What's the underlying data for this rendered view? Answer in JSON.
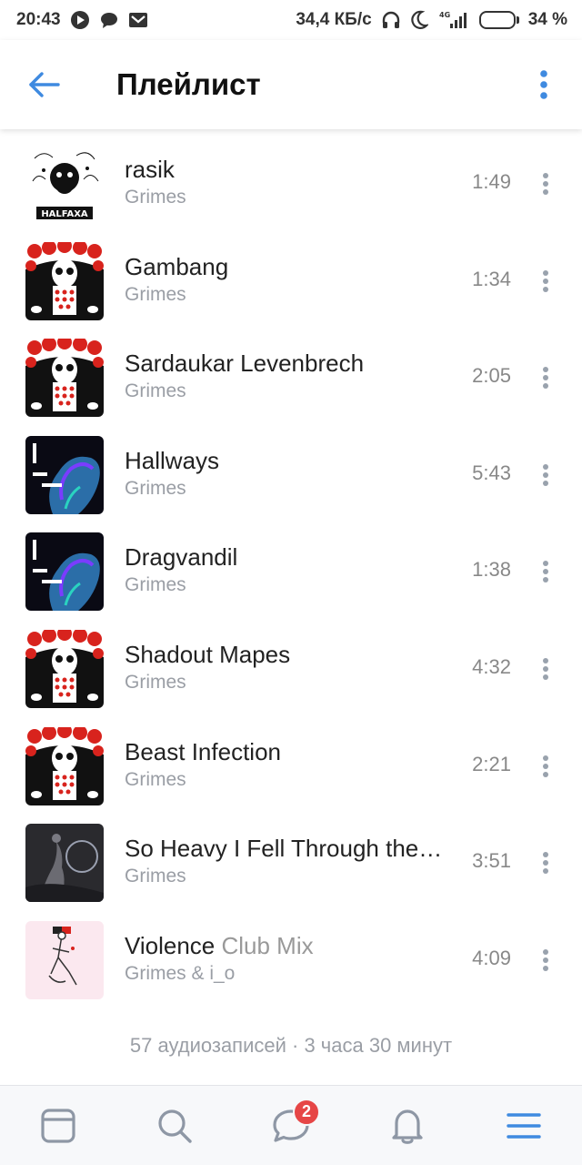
{
  "status_bar": {
    "time": "20:43",
    "network_speed": "34,4 КБ/с",
    "signal": "4G",
    "battery_percent": "34 %",
    "battery_level": 0.34,
    "notification_icons": [
      "play-circle-icon",
      "chat-bubble-icon",
      "gmail-icon"
    ]
  },
  "header": {
    "title": "Плейлист"
  },
  "tracks": [
    {
      "title": "rasik",
      "subtitle": "",
      "artist": "Grimes",
      "duration": "1:49",
      "cover": "halfaxa"
    },
    {
      "title": "Gambang",
      "subtitle": "",
      "artist": "Grimes",
      "duration": "1:34",
      "cover": "geidi"
    },
    {
      "title": "Sardaukar Levenbrech",
      "subtitle": "",
      "artist": "Grimes",
      "duration": "2:05",
      "cover": "geidi"
    },
    {
      "title": "Hallways",
      "subtitle": "",
      "artist": "Grimes",
      "duration": "5:43",
      "cover": "blue"
    },
    {
      "title": "Dragvandil",
      "subtitle": "",
      "artist": "Grimes",
      "duration": "1:38",
      "cover": "blue"
    },
    {
      "title": "Shadout Mapes",
      "subtitle": "",
      "artist": "Grimes",
      "duration": "4:32",
      "cover": "geidi"
    },
    {
      "title": "Beast Infection",
      "subtitle": "",
      "artist": "Grimes",
      "duration": "2:21",
      "cover": "geidi"
    },
    {
      "title": "So Heavy I Fell Through the…",
      "subtitle": "",
      "artist": "Grimes",
      "duration": "3:51",
      "cover": "dark"
    },
    {
      "title": "Violence",
      "subtitle": "Club Mix",
      "artist": "Grimes & i_o",
      "duration": "4:09",
      "cover": "pink"
    }
  ],
  "summary": "57 аудиозаписей · 3 часа 30 минут",
  "bottom_nav": {
    "items": [
      "news-icon",
      "search-icon",
      "messages-icon",
      "notifications-icon",
      "menu-icon"
    ],
    "messages_badge": "2"
  },
  "colors": {
    "accent": "#3f8ae0",
    "badge": "#e64646",
    "secondary_text": "#9a9ea5"
  }
}
